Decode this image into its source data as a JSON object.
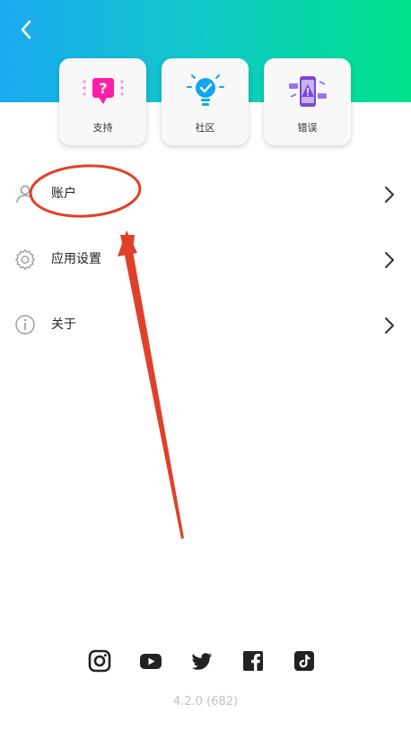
{
  "quick_actions": [
    {
      "label": "支持",
      "icon": "support-question-icon"
    },
    {
      "label": "社区",
      "icon": "community-bulb-icon"
    },
    {
      "label": "错误",
      "icon": "bug-phone-icon"
    }
  ],
  "menu": [
    {
      "label": "账户",
      "icon": "user-icon"
    },
    {
      "label": "应用设置",
      "icon": "gear-icon"
    },
    {
      "label": "关于",
      "icon": "info-icon"
    }
  ],
  "social": [
    "instagram-icon",
    "youtube-icon",
    "twitter-icon",
    "facebook-icon",
    "tiktok-icon"
  ],
  "version": "4.2.0 (682)",
  "colors": {
    "header_gradient_start": "#1ba9f2",
    "header_gradient_end": "#00e38a",
    "support_accent": "#ff1ea8",
    "community_accent": "#12a6f0",
    "bug_accent": "#7a47d8",
    "annotation": "#e0402a"
  }
}
